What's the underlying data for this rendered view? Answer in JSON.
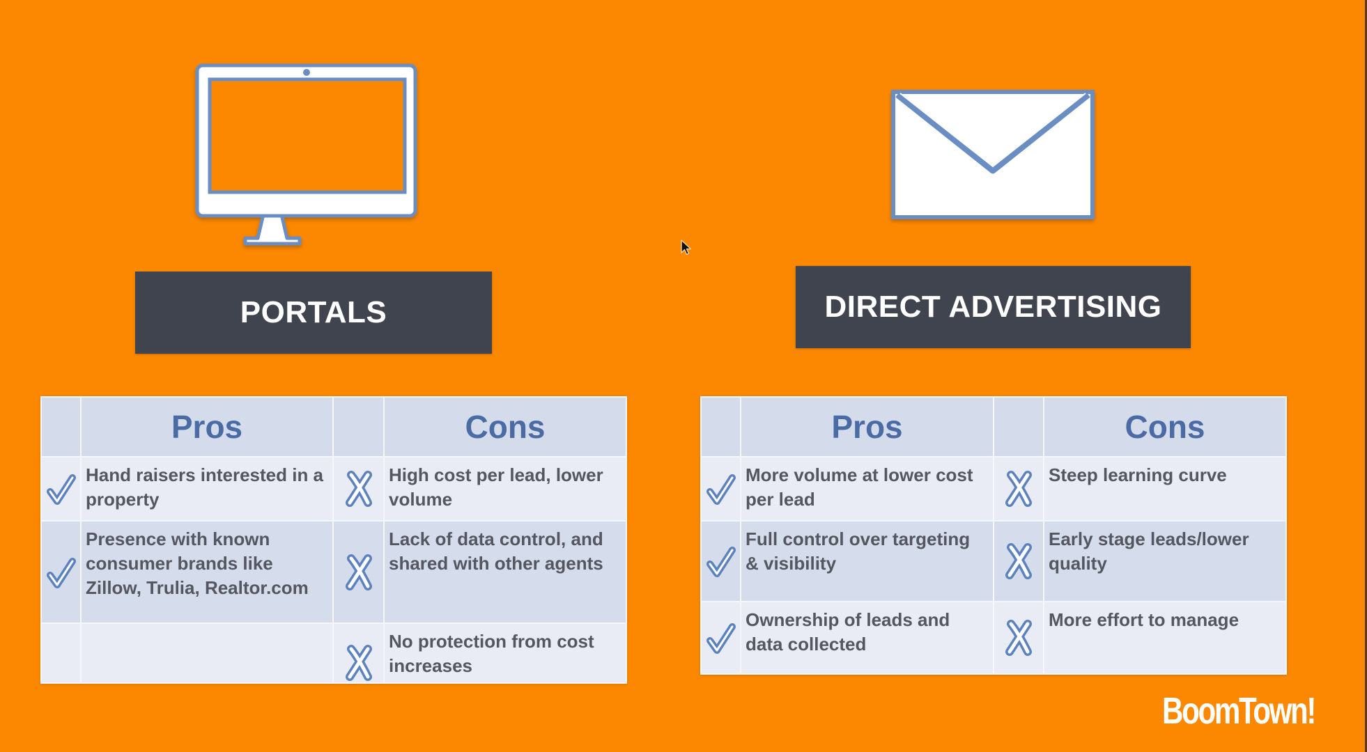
{
  "slide": {
    "background_color": "#fb8800",
    "accent_color": "#4a6ba3",
    "title_bar_color": "#40444e"
  },
  "portals": {
    "icon": "monitor-icon",
    "title": "PORTALS",
    "header": {
      "pros": "Pros",
      "cons": "Cons"
    },
    "rows": [
      {
        "pro": "Hand raisers interested in a property",
        "con": "High cost per lead, lower volume"
      },
      {
        "pro": "Presence with known consumer brands like Zillow, Trulia, Realtor.com",
        "con": "Lack of data control, and shared with other agents"
      },
      {
        "pro": "",
        "con": "No protection from cost increases"
      }
    ]
  },
  "direct_advertising": {
    "icon": "envelope-icon",
    "title": "DIRECT ADVERTISING",
    "header": {
      "pros": "Pros",
      "cons": "Cons"
    },
    "rows": [
      {
        "pro": "More volume at lower cost per lead",
        "con": "Steep learning curve"
      },
      {
        "pro": "Full control over targeting & visibility",
        "con": "Early stage leads/lower quality"
      },
      {
        "pro": "Ownership of leads and data collected",
        "con": "More effort to manage"
      }
    ]
  },
  "logo": {
    "text": "BoomTown!"
  }
}
